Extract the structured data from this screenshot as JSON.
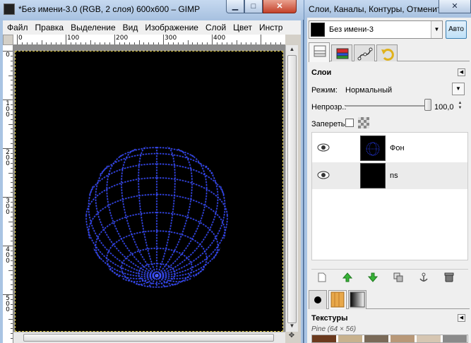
{
  "main_window": {
    "title": "*Без имени-3.0 (RGB, 2 слоя) 600x600 – GIMP",
    "menu": [
      "Файл",
      "Правка",
      "Выделение",
      "Вид",
      "Изображение",
      "Слой",
      "Цвет",
      "Инстр"
    ],
    "ruler_top_labels": [
      "0",
      "100",
      "200",
      "300",
      "400"
    ],
    "ruler_left_labels": [
      "0",
      "100",
      "200",
      "300",
      "400",
      "500"
    ],
    "canvas": {
      "background": "#000000",
      "sphere_color": "#2a3fff",
      "sphere_glow": "#7d8cff"
    }
  },
  "dock_window": {
    "title": "Слои, Каналы, Контуры, Отменить - ...",
    "image_selector": "Без имени-3",
    "auto_button": "Авто",
    "tabs": [
      "layers-tab",
      "channels-tab",
      "paths-tab",
      "undo-tab"
    ],
    "layers": {
      "header": "Слои",
      "mode_label": "Режим:",
      "mode_value": "Нормальный",
      "opacity_label": "Непрозр.:",
      "opacity_value": "100,0",
      "opacity_fraction": 1.0,
      "lock_label": "Запереть:",
      "items": [
        {
          "name": "Фон",
          "visible": true,
          "thumb": "sphere"
        },
        {
          "name": "ns",
          "visible": true,
          "thumb": "black"
        }
      ],
      "actions": [
        "new-layer-icon",
        "raise-layer-icon",
        "lower-layer-icon",
        "duplicate-layer-icon",
        "anchor-layer-icon",
        "delete-layer-icon"
      ]
    },
    "brush_tabs": [
      "brushes-tab",
      "patterns-tab",
      "gradients-tab"
    ],
    "textures": {
      "header": "Текстуры",
      "selected": "Pine (64 × 56)",
      "swatches": [
        "#6b3a1e",
        "#c8b28e",
        "#7a6a58",
        "#b89878",
        "#d6c6b2",
        "#8a8a8a"
      ]
    }
  }
}
